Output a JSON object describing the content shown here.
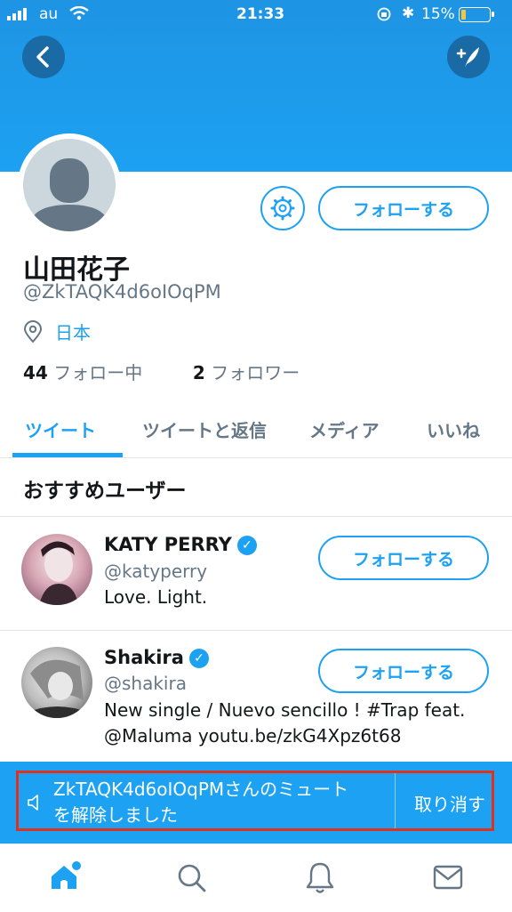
{
  "status_bar": {
    "carrier": "au",
    "time": "21:33",
    "battery": "15%"
  },
  "header": {
    "back_icon": "chevron-left-icon",
    "compose_icon": "compose-tweet-icon"
  },
  "profile": {
    "name": "山田花子",
    "handle": "@ZkTAQK4d6oIOqPM",
    "location": "日本",
    "following_count": "44",
    "following_label": "フォロー中",
    "followers_count": "2",
    "followers_label": "フォロワー",
    "follow_button": "フォローする"
  },
  "tabs": [
    {
      "label": "ツイート",
      "active": true
    },
    {
      "label": "ツイートと返信",
      "active": false
    },
    {
      "label": "メディア",
      "active": false
    },
    {
      "label": "いいね",
      "active": false
    }
  ],
  "suggestions": {
    "title": "おすすめユーザー",
    "users": [
      {
        "name": "KATY PERRY",
        "handle": "@katyperry",
        "bio": "Love. Light.",
        "verified": true,
        "follow": "フォローする"
      },
      {
        "name": "Shakira",
        "handle": "@shakira",
        "bio_line1": "New single / Nuevo sencillo ! #Trap feat.",
        "bio_line2": "@Maluma youtu.be/zkG4Xpz6t68",
        "verified": true,
        "follow": "フォローする"
      }
    ]
  },
  "toast": {
    "message_line1": "ZkTAQK4d6oIOqPMさんのミュート",
    "message_line2": "を解除しました",
    "undo": "取り消す"
  },
  "tab_bar": {
    "items": [
      "home-icon",
      "search-icon",
      "notifications-icon",
      "messages-icon"
    ]
  },
  "colors": {
    "accent": "#1da1f2",
    "highlight_frame": "#e0301e"
  }
}
